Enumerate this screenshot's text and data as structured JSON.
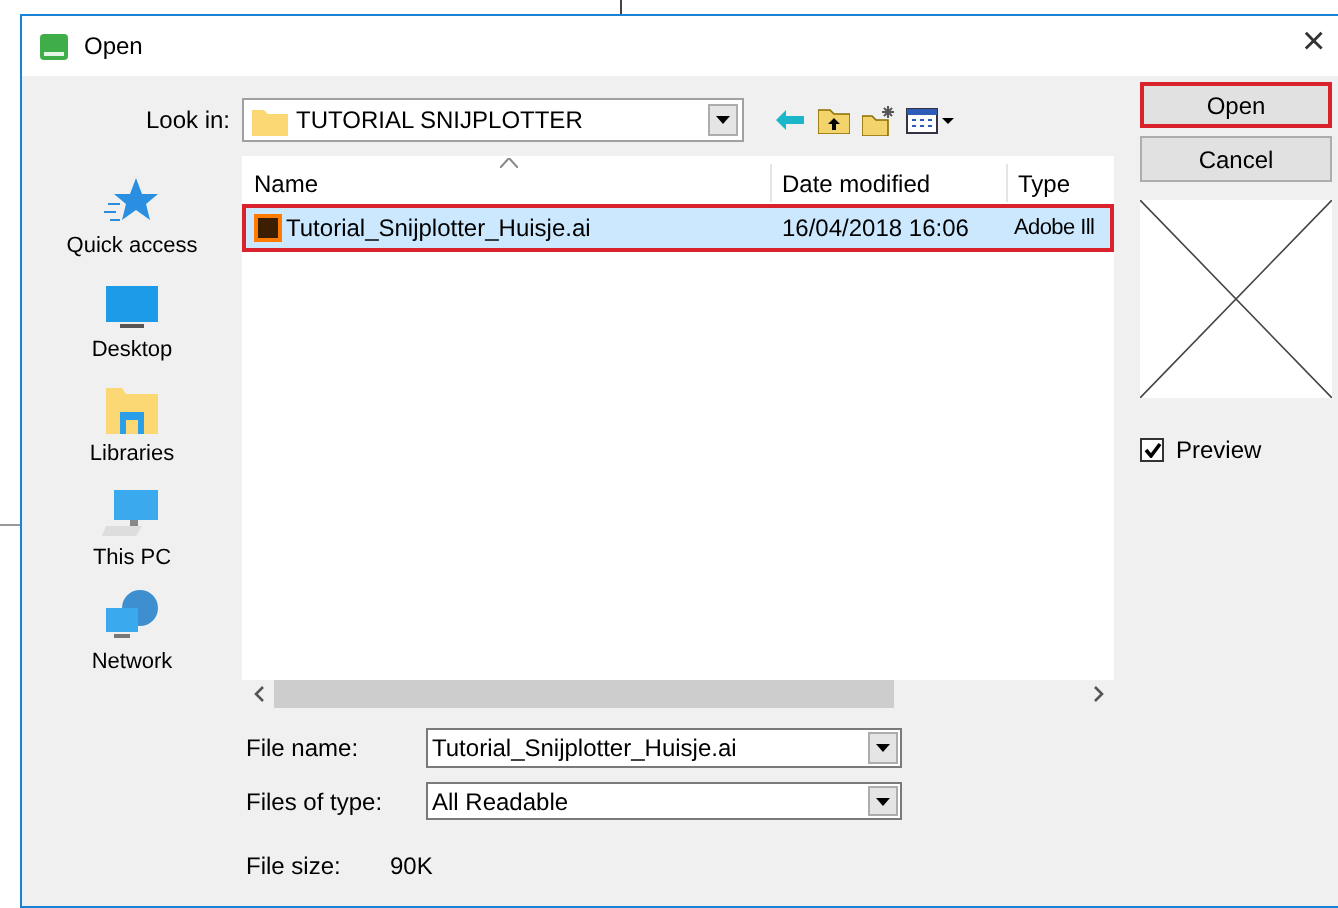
{
  "window": {
    "title": "Open",
    "close": "×"
  },
  "look_in": {
    "label": "Look in:",
    "value": "TUTORIAL SNIJPLOTTER"
  },
  "places": [
    {
      "label": "Quick access",
      "kind": "star"
    },
    {
      "label": "Desktop",
      "kind": "desktop"
    },
    {
      "label": "Libraries",
      "kind": "library"
    },
    {
      "label": "This PC",
      "kind": "pc"
    },
    {
      "label": "Network",
      "kind": "network"
    }
  ],
  "file_list": {
    "columns": [
      "Name",
      "Date modified",
      "Type"
    ],
    "rows": [
      {
        "name": "Tutorial_Snijplotter_Huisje.ai",
        "date": "16/04/2018 16:06",
        "type": "Adobe Ill",
        "selected": true
      }
    ]
  },
  "file_name": {
    "label": "File name:",
    "value": "Tutorial_Snijplotter_Huisje.ai"
  },
  "file_type": {
    "label": "Files of type:",
    "value": "All Readable"
  },
  "file_size": {
    "label": "File size:",
    "value": "90K"
  },
  "buttons": [
    {
      "label": "Open",
      "highlighted": true
    },
    {
      "label": "Cancel",
      "highlighted": false
    }
  ],
  "preview": {
    "label": "Preview",
    "checked": true
  }
}
